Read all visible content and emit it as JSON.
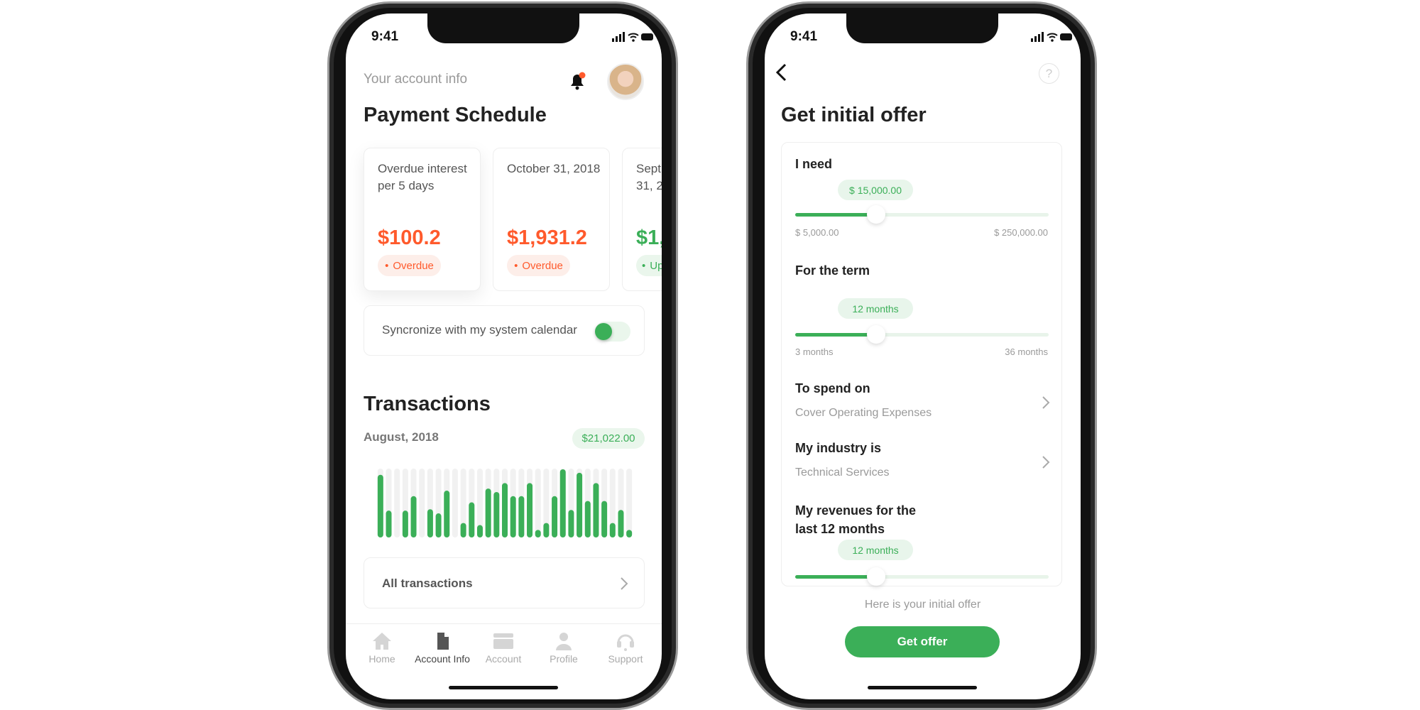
{
  "colors": {
    "accent": "#3BAF58",
    "overdue": "#FF5A2C",
    "text": "#333333",
    "muted": "#9A9A9A"
  },
  "status_bar": {
    "time": "9:41"
  },
  "account": {
    "header_subtitle": "Your account info",
    "title": "Payment Schedule",
    "notification_dot": true,
    "cards": [
      {
        "label": "Overdue interest per 5 days",
        "amount": "$100.2",
        "status": "Overdue",
        "status_type": "overdue"
      },
      {
        "label": "October 31, 2018",
        "amount": "$1,931.2",
        "status": "Overdue",
        "status_type": "overdue"
      },
      {
        "label": "Sept 31, 2",
        "amount": "$1,",
        "status": "Up",
        "status_type": "upcoming"
      }
    ],
    "sync": {
      "label": "Syncronize with my system calendar",
      "enabled": true
    },
    "transactions": {
      "title": "Transactions",
      "month": "August, 2018",
      "total": "$21,022.00",
      "all_label": "All transactions"
    },
    "tabs": [
      {
        "label": "Home",
        "icon": "home-icon",
        "active": false
      },
      {
        "label": "Account Info",
        "icon": "document-icon",
        "active": true
      },
      {
        "label": "Account",
        "icon": "card-icon",
        "active": false
      },
      {
        "label": "Profile",
        "icon": "person-icon",
        "active": false
      },
      {
        "label": "Support",
        "icon": "headset-icon",
        "active": false
      }
    ]
  },
  "chart_data": {
    "type": "bar",
    "values": [
      0.91,
      0.39,
      0,
      0.39,
      0.6,
      0,
      0.41,
      0.35,
      0.68,
      0,
      0.21,
      0.51,
      0.18,
      0.71,
      0.66,
      0.79,
      0.6,
      0.6,
      0.79,
      0.11,
      0.21,
      0.6,
      0.99,
      0.4,
      0.94,
      0.53,
      0.79,
      0.53,
      0.21,
      0.4,
      0.11
    ],
    "ylim": [
      0,
      1
    ],
    "grid": false
  },
  "offer": {
    "title": "Get initial offer",
    "need": {
      "label": "I need",
      "value": "$ 15,000.00",
      "min": "$ 5,000.00",
      "max": "$ 250,000.00",
      "fill": 0.32
    },
    "term": {
      "label": "For the term",
      "value": "12 months",
      "min": "3 months",
      "max": "36 months",
      "fill": 0.32
    },
    "spend": {
      "label": "To spend on",
      "value": "Cover Operating Expenses"
    },
    "industry": {
      "label": "My industry is",
      "value": "Technical Services"
    },
    "revenue": {
      "label_line1": "My revenues for the",
      "label_line2": "last 12 months",
      "value": "12 months",
      "fill": 0.32
    },
    "footer_text": "Here is your initial offer",
    "button": "Get offer"
  }
}
